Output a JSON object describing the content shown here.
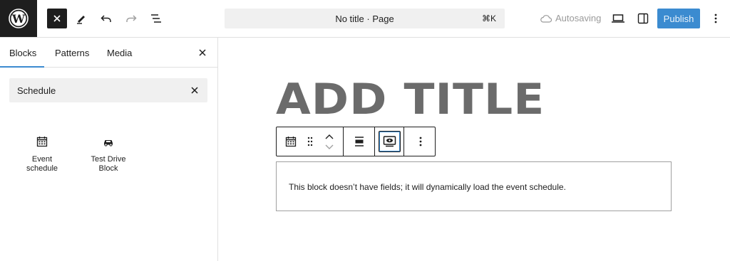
{
  "topbar": {
    "document_title": "No title · Page",
    "shortcut": "⌘K",
    "autosave_label": "Autosaving",
    "publish_label": "Publish"
  },
  "sidebar": {
    "tabs": [
      {
        "label": "Blocks",
        "active": true
      },
      {
        "label": "Patterns",
        "active": false
      },
      {
        "label": "Media",
        "active": false
      }
    ],
    "search": {
      "value": "Schedule"
    },
    "blocks": [
      {
        "label": "Event\nschedule",
        "icon": "calendar-icon"
      },
      {
        "label": "Test Drive\nBlock",
        "icon": "car-icon"
      }
    ]
  },
  "canvas": {
    "title_placeholder": "ADD TITLE",
    "block_message": "This block doesn’t have fields; it will dynamically load the event schedule."
  },
  "colors": {
    "accent": "#3b8bd0",
    "dark": "#1e1e1e",
    "title_gray": "#6b6b6b"
  }
}
